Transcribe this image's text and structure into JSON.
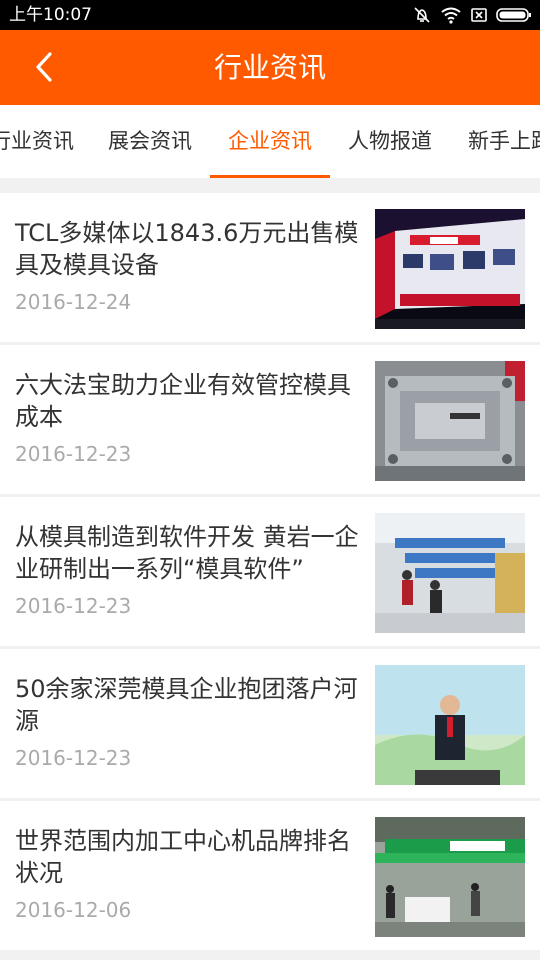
{
  "status_bar": {
    "time": "上午10:07"
  },
  "header": {
    "title": "行业资讯",
    "back_icon": "chevron-left-icon"
  },
  "tabs": [
    {
      "label": "行业资讯",
      "active": false
    },
    {
      "label": "展会资讯",
      "active": false
    },
    {
      "label": "企业资讯",
      "active": true
    },
    {
      "label": "人物报道",
      "active": false
    },
    {
      "label": "新手上路",
      "active": false
    }
  ],
  "colors": {
    "accent": "#ff5a00",
    "background": "#f1f1f1",
    "title_text": "#333333",
    "date_text": "#aaaaaa"
  },
  "articles": [
    {
      "title": "TCL多媒体以1843.6万元出售模具及模具设备",
      "date": "2016-12-24",
      "thumb": "tcl-booth-photo"
    },
    {
      "title": "六大法宝助力企业有效管控模具成本",
      "date": "2016-12-23",
      "thumb": "mold-photo"
    },
    {
      "title": "从模具制造到软件开发 黄岩一企业研制出一系列“模具软件”",
      "date": "2016-12-23",
      "thumb": "office-photo"
    },
    {
      "title": "50余家深莞模具企业抱团落户河源",
      "date": "2016-12-23",
      "thumb": "speaker-photo"
    },
    {
      "title": "世界范围内加工中心机品牌排名状况",
      "date": "2016-12-06",
      "thumb": "exhibition-photo"
    }
  ]
}
